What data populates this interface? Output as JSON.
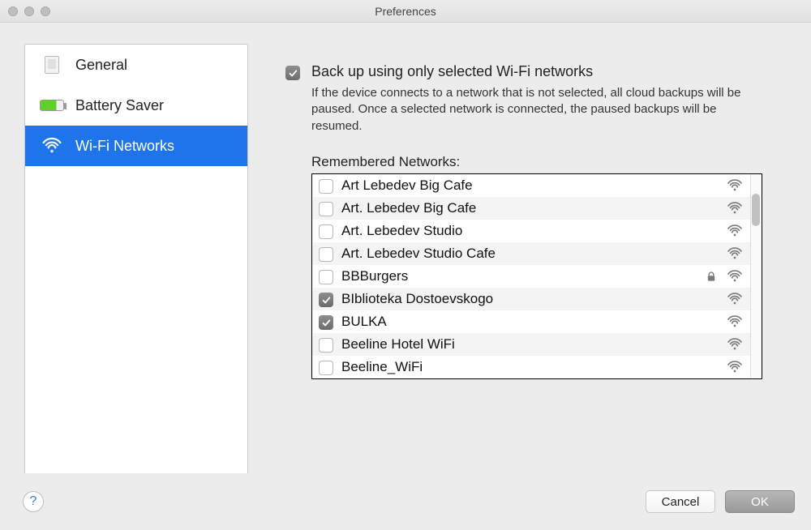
{
  "window": {
    "title": "Preferences"
  },
  "sidebar": {
    "items": [
      {
        "label": "General",
        "icon": "general-icon",
        "selected": false
      },
      {
        "label": "Battery Saver",
        "icon": "battery-icon",
        "selected": false
      },
      {
        "label": "Wi-Fi Networks",
        "icon": "wifi-icon",
        "selected": true
      }
    ]
  },
  "content": {
    "backup_checkbox": {
      "checked": true
    },
    "backup_label": "Back up using only selected Wi-Fi networks",
    "backup_description": "If the device connects to a network that is not selected, all cloud backups will be paused. Once a selected network is connected, the paused backups will be resumed.",
    "remembered_label": "Remembered Networks:",
    "networks": [
      {
        "name": "Art Lebedev Big Cafe",
        "checked": false,
        "locked": false
      },
      {
        "name": "Art. Lebedev Big Cafe",
        "checked": false,
        "locked": false
      },
      {
        "name": "Art. Lebedev Studio",
        "checked": false,
        "locked": false
      },
      {
        "name": "Art. Lebedev Studio Cafe",
        "checked": false,
        "locked": false
      },
      {
        "name": "BBBurgers",
        "checked": false,
        "locked": true
      },
      {
        "name": "BIblioteka Dostoevskogo",
        "checked": true,
        "locked": false
      },
      {
        "name": "BULKA",
        "checked": true,
        "locked": false
      },
      {
        "name": "Beeline Hotel WiFi",
        "checked": false,
        "locked": false
      },
      {
        "name": "Beeline_WiFi",
        "checked": false,
        "locked": false
      }
    ]
  },
  "footer": {
    "help_label": "?",
    "cancel_label": "Cancel",
    "ok_label": "OK"
  }
}
